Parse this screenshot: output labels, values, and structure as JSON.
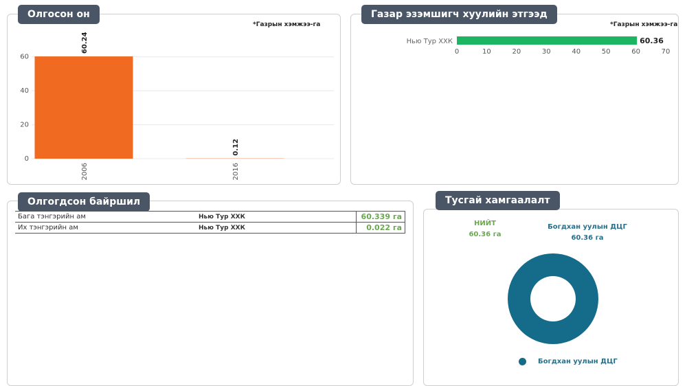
{
  "panels": {
    "year": {
      "title": "Олгосон он",
      "note": "*Газрын хэмжээ-га"
    },
    "holder": {
      "title": "Газар эзэмшигч  хуулийн этгээд",
      "note": "*Газрын хэмжээ-га"
    },
    "location": {
      "title": "Олгогдсон байршил",
      "rows": [
        {
          "place": "Бага тэнгэрийн ам",
          "holder": "Нью Тур ХХК",
          "area": "60.339 га"
        },
        {
          "place": "Их тэнгэрийн ам",
          "holder": "Нью Тур ХХК",
          "area": "0.022 га"
        }
      ]
    },
    "protected": {
      "title": "Тусгай хамгаалалт",
      "total_label": "НИЙТ",
      "total_value": "60.36 га",
      "segment_label": "Богдхан уулын ДЦГ",
      "segment_value": "60.36 га",
      "legend": "Богдхан уулын ДЦГ"
    }
  },
  "chart_data": [
    {
      "type": "bar",
      "orientation": "vertical",
      "categories": [
        "2006",
        "2016"
      ],
      "values": [
        60.24,
        0.12
      ],
      "ylim": [
        0,
        70
      ],
      "yticks": [
        0,
        20,
        40,
        60
      ],
      "color": "#f06a22",
      "grid": true
    },
    {
      "type": "bar",
      "orientation": "horizontal",
      "categories": [
        "Нью Тур ХХК"
      ],
      "values": [
        60.36
      ],
      "xlim": [
        0,
        70
      ],
      "xticks": [
        0,
        10,
        20,
        30,
        40,
        50,
        60,
        70
      ],
      "color": "#1db562"
    },
    {
      "type": "pie",
      "style": "donut",
      "labels": [
        "Богдхан уулын ДЦГ"
      ],
      "values": [
        60.36
      ],
      "color": "#146b8a"
    }
  ],
  "colors": {
    "title_bg": "#4a5566",
    "green_text": "#6aa84f",
    "teal_text": "#2a6f8a"
  }
}
